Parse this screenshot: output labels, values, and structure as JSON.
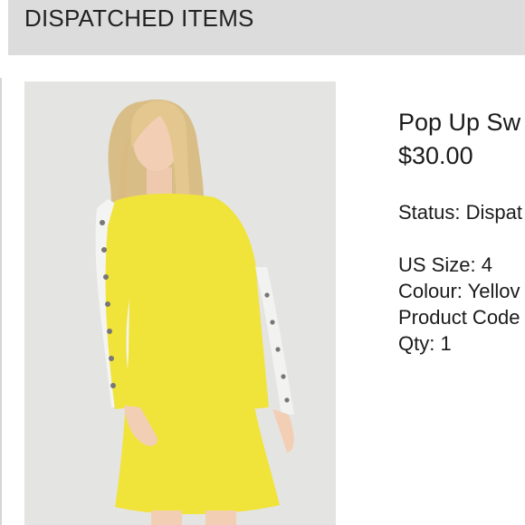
{
  "header": {
    "title": "DISPATCHED ITEMS"
  },
  "product": {
    "name": "Pop Up Sw",
    "price": "$30.00",
    "status": "Status: Dispat",
    "size": "US Size: 4",
    "colour": "Colour: Yellov",
    "code": "Product Code",
    "qty": "Qty: 1",
    "image_description_colors": {
      "dress": "#f0e33a",
      "sleeve_stripe": "#f4f4f2",
      "background": "#e4e4e2"
    }
  }
}
